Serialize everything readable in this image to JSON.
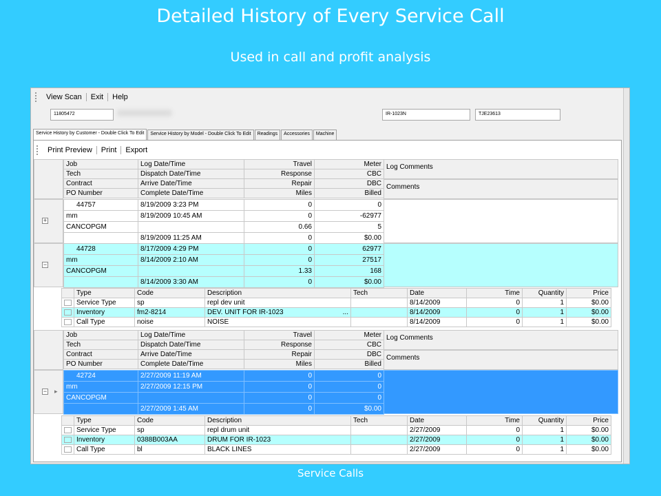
{
  "slide": {
    "title": "Detailed History of Every Service Call",
    "subtitle": "Used in call and profit analysis",
    "caption": "Service Calls"
  },
  "menu": {
    "items": [
      "View Scan",
      "Exit",
      "Help"
    ]
  },
  "fields": {
    "customer_id": "11805472",
    "model": "IR-1023N",
    "serial": "TJE23613"
  },
  "tabs": [
    "Service History by Customer - Double Click To Edit",
    "Service History by Model - Double Click To Edit",
    "Readings",
    "Accessories",
    "Machine"
  ],
  "toolbar": {
    "print_preview": "Print Preview",
    "print": "Print",
    "export": "Export"
  },
  "header": {
    "rows": [
      [
        "Job",
        "Log Date/Time",
        "Travel",
        "Meter"
      ],
      [
        "Tech",
        "Dispatch Date/Time",
        "Response",
        "CBC"
      ],
      [
        "Contract",
        "Arrive Date/Time",
        "Repair",
        "DBC"
      ],
      [
        "PO Number",
        "Complete Date/Time",
        "Miles",
        "Billed"
      ]
    ],
    "log_comments": "Log Comments",
    "comments": "Comments"
  },
  "calls": [
    {
      "rows": [
        [
          "44757",
          "8/19/2009 3:23 PM",
          "0",
          "0"
        ],
        [
          "mm",
          "8/19/2009 10:45 AM",
          "0",
          "-62977"
        ],
        [
          "CANCOPGM",
          "",
          "0.66",
          "5"
        ],
        [
          "",
          "8/19/2009 11:25 AM",
          "0",
          "$0.00"
        ]
      ]
    },
    {
      "rows": [
        [
          "44728",
          "8/17/2009 4:29 PM",
          "0",
          "62977"
        ],
        [
          "mm",
          "8/14/2009 2:10 AM",
          "0",
          "27517"
        ],
        [
          "CANCOPGM",
          "",
          "1.33",
          "168"
        ],
        [
          "",
          "8/14/2009 3:30 AM",
          "0",
          "$0.00"
        ]
      ]
    },
    {
      "rows": [
        [
          "42724",
          "2/27/2009 11:19 AM",
          "0",
          "0"
        ],
        [
          "mm",
          "2/27/2009 12:15 PM",
          "0",
          "0"
        ],
        [
          "CANCOPGM",
          "",
          "0",
          "0"
        ],
        [
          "",
          "2/27/2009 1:45 AM",
          "0",
          "$0.00"
        ]
      ]
    }
  ],
  "detail_header": [
    "Type",
    "Code",
    "Description",
    "Tech",
    "Date",
    "Time",
    "Quantity",
    "Price"
  ],
  "details1": [
    [
      "Service Type",
      "sp",
      "repl dev unit",
      "",
      "8/14/2009",
      "0",
      "1",
      "$0.00"
    ],
    [
      "Inventory",
      "fm2-8214",
      "DEV. UNIT FOR IR-1023",
      "",
      "8/14/2009",
      "0",
      "1",
      "$0.00"
    ],
    [
      "Call Type",
      "noise",
      "NOISE",
      "",
      "8/14/2009",
      "0",
      "1",
      "$0.00"
    ]
  ],
  "details1_ellipsis": "...",
  "details2": [
    [
      "Service Type",
      "sp",
      "repl drum unit",
      "",
      "2/27/2009",
      "0",
      "1",
      "$0.00"
    ],
    [
      "Inventory",
      "0388B003AA",
      "DRUM FOR IR-1023",
      "",
      "2/27/2009",
      "0",
      "1",
      "$0.00"
    ],
    [
      "Call Type",
      "bl",
      "BLACK LINES",
      "",
      "2/27/2009",
      "0",
      "1",
      "$0.00"
    ]
  ],
  "colors": {
    "background": "#33ccff",
    "row_highlight": "#b6fffe",
    "selected": "#3399ff"
  }
}
